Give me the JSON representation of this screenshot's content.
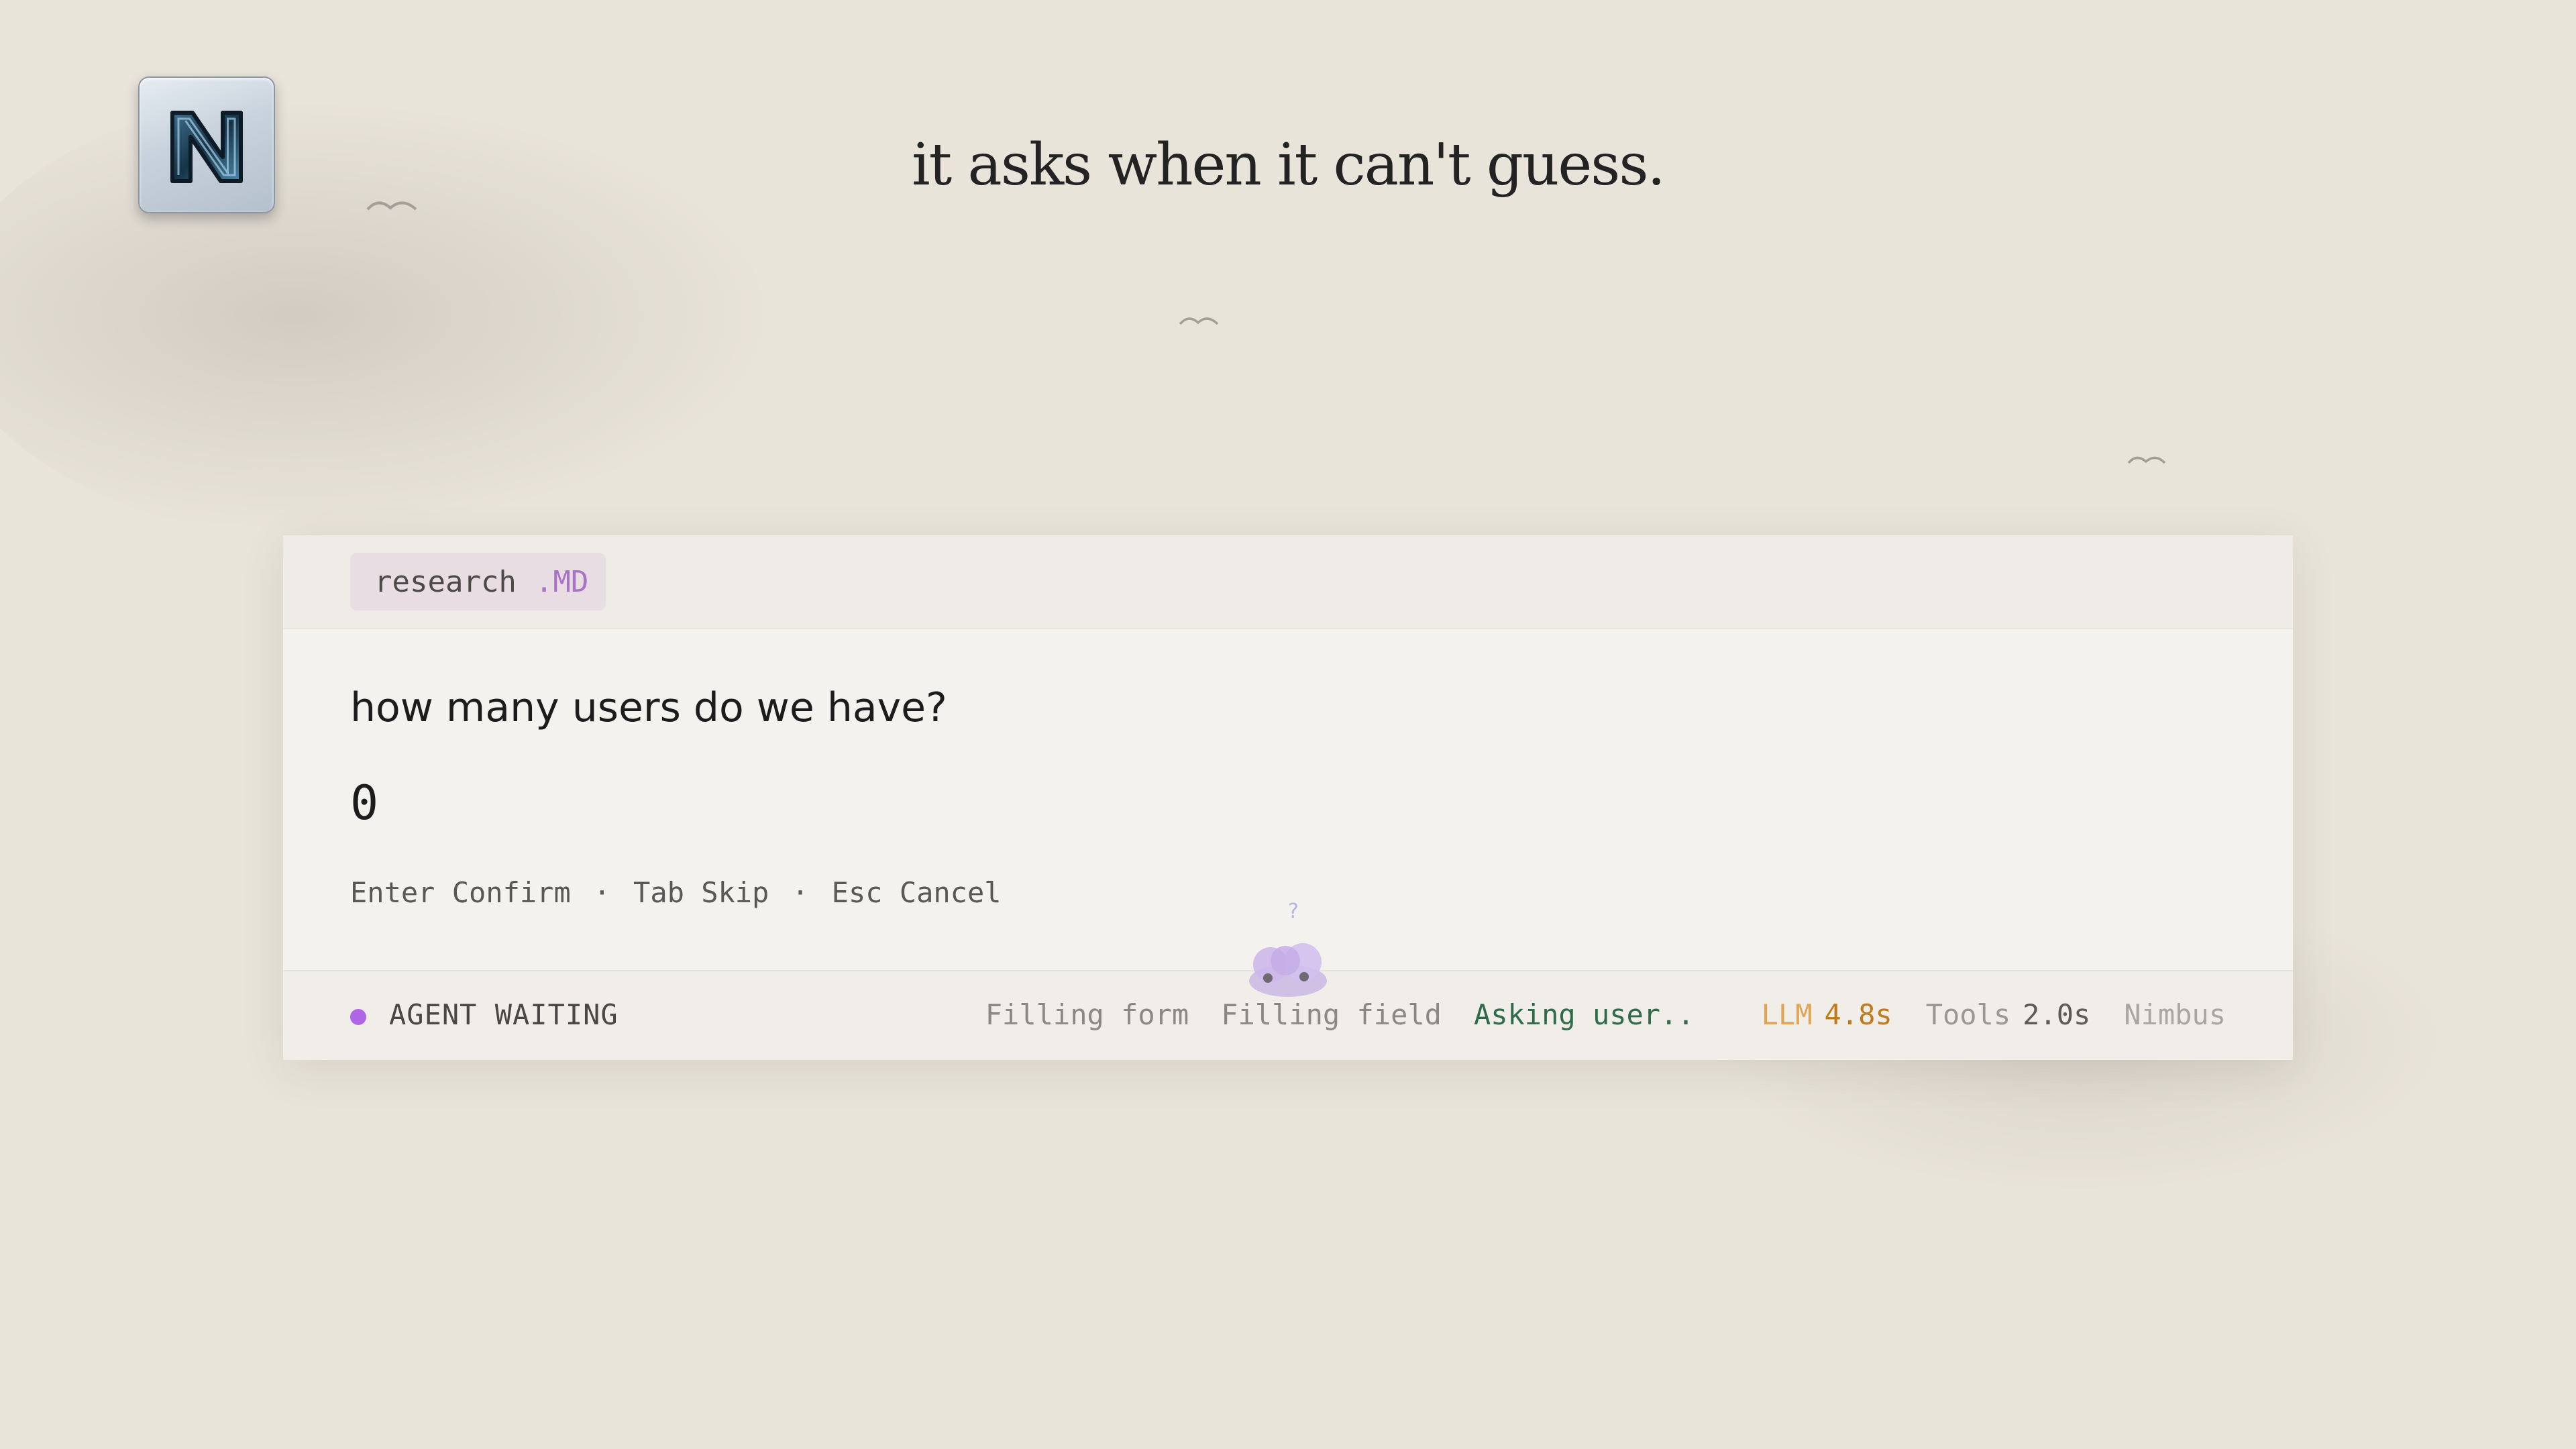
{
  "headline": "it asks when it can't guess.",
  "logo": {
    "icon": "n-letter-logo-icon"
  },
  "file": {
    "name": "research",
    "ext": ".MD"
  },
  "question": {
    "prompt": "how many users do we have?",
    "answer_value": "0"
  },
  "hints": [
    {
      "key": "Enter",
      "label": "Confirm"
    },
    {
      "key": "Tab",
      "label": "Skip"
    },
    {
      "key": "Esc",
      "label": "Cancel"
    }
  ],
  "hint_separator": "·",
  "status": {
    "label": "AGENT WAITING",
    "dot_color": "#b065e8",
    "steps": [
      "Filling form",
      "Filling field"
    ],
    "active_step": "Asking user..",
    "llm_label": "LLM",
    "llm_time": "4.8s",
    "tools_label": "Tools",
    "tools_time": "2.0s",
    "brand": "Nimbus"
  },
  "mascot": {
    "icon": "cloud-mascot-icon",
    "bubble": "?"
  },
  "colors": {
    "background": "#e9e4da",
    "accent": "#a774c4",
    "active": "#2f6b4a",
    "llm": "#c07a1c"
  }
}
